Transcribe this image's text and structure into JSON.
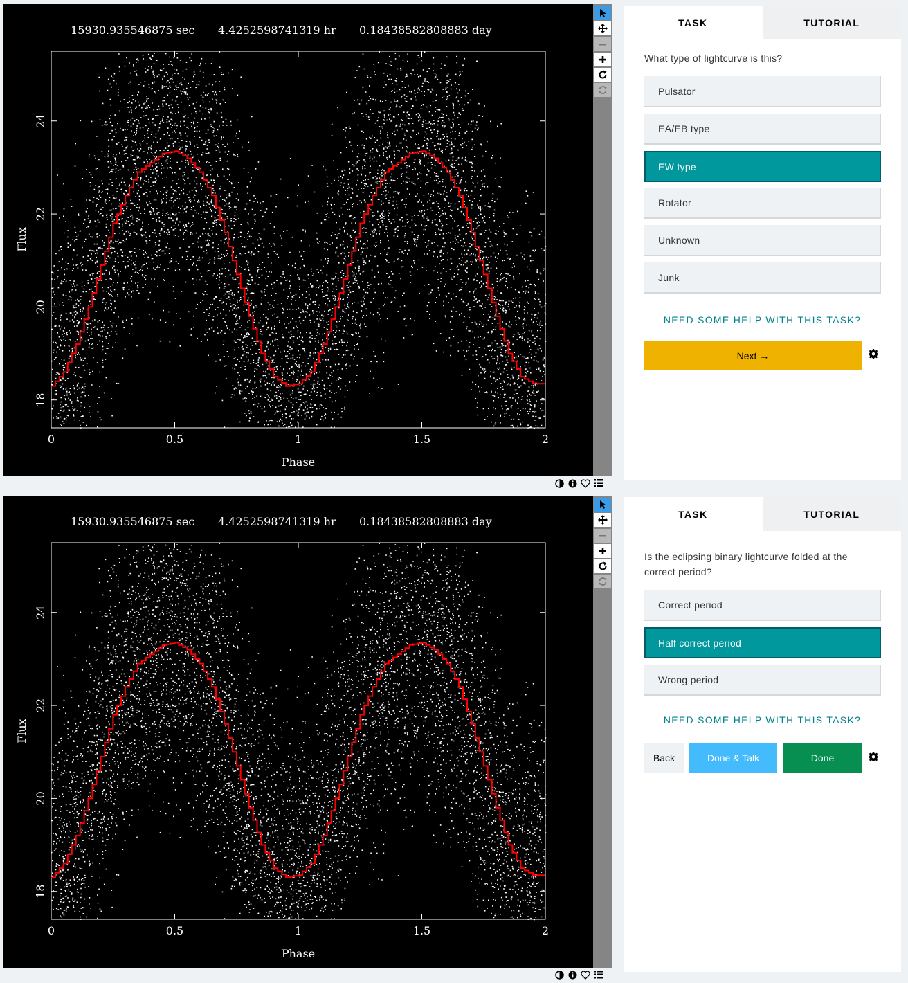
{
  "header_readout": {
    "sec": "15930.935546875 sec",
    "hr": "4.4252598741319  hr",
    "day": "0.18438582808883 day"
  },
  "chart_data": {
    "type": "scatter",
    "title": "",
    "xlabel": "Phase",
    "ylabel": "Flux",
    "xlim": [
      0,
      2
    ],
    "ylim": [
      17.4,
      25.5
    ],
    "x_ticks": [
      "0",
      "0.5",
      "1",
      "1.5",
      "2"
    ],
    "y_ticks": [
      "18",
      "20",
      "22",
      "24"
    ],
    "x_tick_values": [
      0,
      0.5,
      1,
      1.5,
      2
    ],
    "y_tick_values": [
      18,
      20,
      22,
      24
    ],
    "series": [
      {
        "kind": "folded-model-curve",
        "color": "#ff0000",
        "x": [
          0,
          0.05,
          0.1,
          0.15,
          0.2,
          0.25,
          0.3,
          0.35,
          0.4,
          0.45,
          0.5,
          0.55,
          0.6,
          0.65,
          0.7,
          0.75,
          0.8,
          0.85,
          0.9,
          0.95,
          1.0,
          1.05,
          1.1,
          1.15,
          1.2,
          1.25,
          1.3,
          1.35,
          1.4,
          1.45,
          1.5,
          1.55,
          1.6,
          1.65,
          1.7,
          1.75,
          1.8,
          1.85,
          1.9,
          1.95,
          2.0
        ],
        "y": [
          18.3,
          18.6,
          19.2,
          20.0,
          20.9,
          21.8,
          22.4,
          22.9,
          23.1,
          23.3,
          23.35,
          23.2,
          22.9,
          22.4,
          21.6,
          20.7,
          19.8,
          19.0,
          18.5,
          18.3,
          18.35,
          18.6,
          19.2,
          20.0,
          20.9,
          21.8,
          22.4,
          22.9,
          23.1,
          23.3,
          23.35,
          23.2,
          22.9,
          22.4,
          21.6,
          20.7,
          19.8,
          19.0,
          18.5,
          18.35,
          18.35
        ]
      },
      {
        "kind": "observed-points",
        "color": "#ffffff",
        "scatter_width_flux": 2.6
      }
    ],
    "grid": false,
    "legend": "none"
  },
  "toolbar": {
    "icons": [
      "pointer-icon",
      "pan-icon",
      "zoom-out-icon",
      "zoom-in-icon",
      "rotate-icon",
      "reset-icon"
    ]
  },
  "bottom_icons": [
    "invert-icon",
    "info-icon",
    "favorite-icon",
    "collections-icon"
  ],
  "tabs": {
    "task": "TASK",
    "tutorial": "TUTORIAL"
  },
  "task1": {
    "question": "What type of lightcurve is this?",
    "answers": [
      "Pulsator",
      "EA/EB type",
      "EW type",
      "Rotator",
      "Unknown",
      "Junk"
    ],
    "selected": 2,
    "help": "NEED SOME HELP WITH THIS TASK?",
    "next_label": "Next →"
  },
  "task2": {
    "question": "Is the eclipsing binary lightcurve folded at the correct period?",
    "answers": [
      "Correct period",
      "Half correct period",
      "Wrong period"
    ],
    "selected": 1,
    "help": "NEED SOME HELP WITH THIS TASK?",
    "back_label": "Back",
    "talk_label": "Done & Talk",
    "done_label": "Done"
  },
  "colors": {
    "accent": "#00979d",
    "next": "#f0b200",
    "talk": "#43bbfd",
    "done": "#078f52",
    "help": "#00828c"
  }
}
